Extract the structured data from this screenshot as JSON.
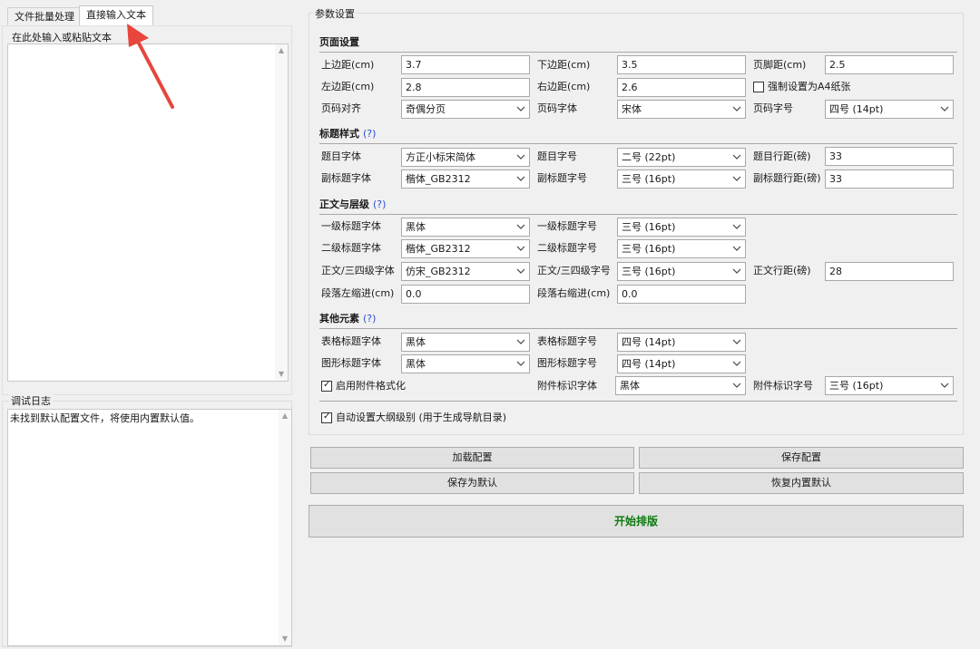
{
  "tabs": [
    {
      "label": "文件批量处理",
      "active": false
    },
    {
      "label": "直接输入文本",
      "active": true
    }
  ],
  "left": {
    "input_title": "在此处输入或粘贴文本",
    "log_title": "调试日志",
    "log_text": "未找到默认配置文件，将使用内置默认值。"
  },
  "params": {
    "title": "参数设置",
    "page": {
      "section": "页面设置",
      "top_label": "上边距(cm)",
      "top_value": "3.7",
      "bottom_label": "下边距(cm)",
      "bottom_value": "3.5",
      "footer_label": "页脚距(cm)",
      "footer_value": "2.5",
      "left_label": "左边距(cm)",
      "left_value": "2.8",
      "right_label": "右边距(cm)",
      "right_value": "2.6",
      "force_a4_label": "强制设置为A4纸张",
      "force_a4_checked": false,
      "align_label": "页码对齐",
      "align_value": "奇偶分页",
      "pn_font_label": "页码字体",
      "pn_font_value": "宋体",
      "pn_size_label": "页码字号",
      "pn_size_value": "四号 (14pt)"
    },
    "title_style": {
      "section": "标题样式",
      "help": "(?)",
      "tfont_label": "题目字体",
      "tfont_value": "方正小标宋简体",
      "tsize_label": "题目字号",
      "tsize_value": "二号 (22pt)",
      "tspacing_label": "题目行距(磅)",
      "tspacing_value": "33",
      "sfont_label": "副标题字体",
      "sfont_value": "楷体_GB2312",
      "ssize_label": "副标题字号",
      "ssize_value": "三号 (16pt)",
      "sspacing_label": "副标题行距(磅)",
      "sspacing_value": "33"
    },
    "body": {
      "section": "正文与层级",
      "help": "(?)",
      "h1font_label": "一级标题字体",
      "h1font_value": "黑体",
      "h1size_label": "一级标题字号",
      "h1size_value": "三号 (16pt)",
      "h2font_label": "二级标题字体",
      "h2font_value": "楷体_GB2312",
      "h2size_label": "二级标题字号",
      "h2size_value": "三号 (16pt)",
      "bfont_label": "正文/三四级字体",
      "bfont_value": "仿宋_GB2312",
      "bsize_label": "正文/三四级字号",
      "bsize_value": "三号 (16pt)",
      "bspacing_label": "正文行距(磅)",
      "bspacing_value": "28",
      "lindent_label": "段落左缩进(cm)",
      "lindent_value": "0.0",
      "rindent_label": "段落右缩进(cm)",
      "rindent_value": "0.0"
    },
    "other": {
      "section": "其他元素",
      "help": "(?)",
      "tblfont_label": "表格标题字体",
      "tblfont_value": "黑体",
      "tblsize_label": "表格标题字号",
      "tblsize_value": "四号 (14pt)",
      "figfont_label": "图形标题字体",
      "figfont_value": "黑体",
      "figsize_label": "图形标题字号",
      "figsize_value": "四号 (14pt)",
      "attach_label": "启用附件格式化",
      "attach_checked": true,
      "afont_label": "附件标识字体",
      "afont_value": "黑体",
      "asize_label": "附件标识字号",
      "asize_value": "三号 (16pt)"
    },
    "outline_label": "自动设置大纲级别 (用于生成导航目录)",
    "outline_checked": true
  },
  "buttons": {
    "load": "加载配置",
    "save": "保存配置",
    "save_default": "保存为默认",
    "restore": "恢复内置默认",
    "start": "开始排版"
  },
  "colors": {
    "annotation_arrow": "#e8453c",
    "start_button_text": "#0d7a0d",
    "help_link": "#2a4fd6"
  }
}
